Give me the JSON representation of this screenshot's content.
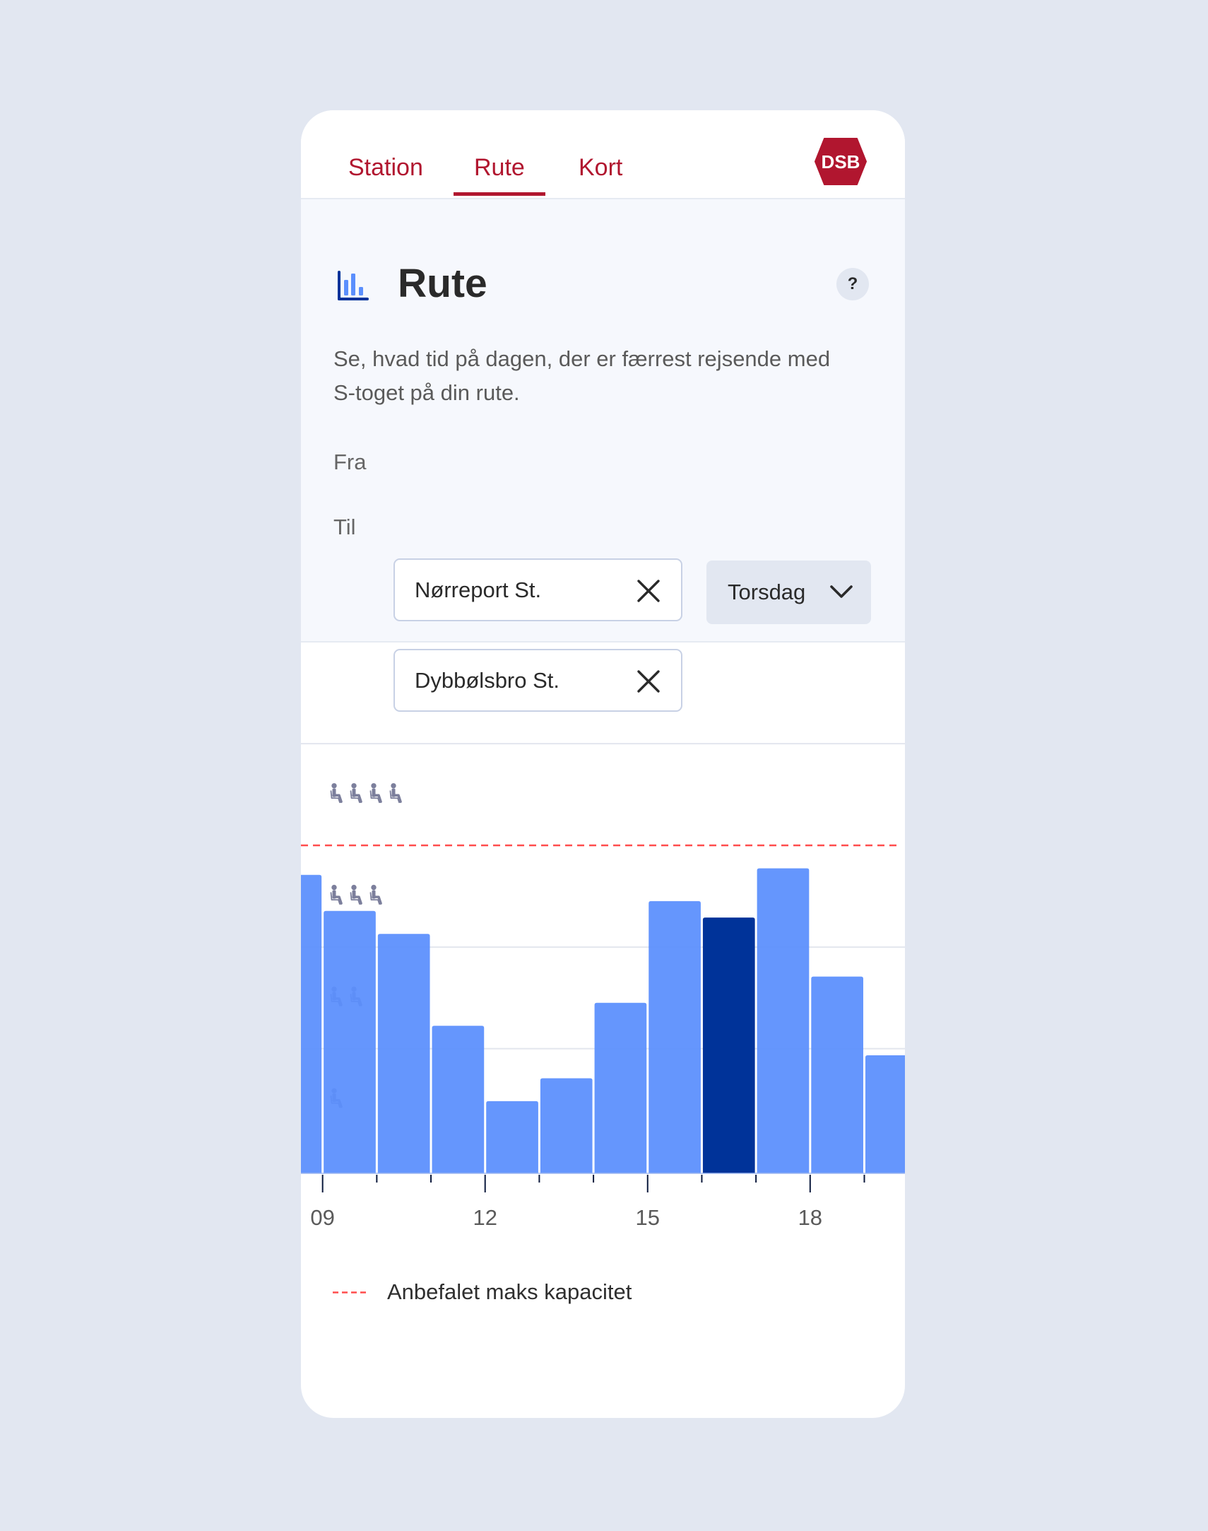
{
  "nav": {
    "tabs": [
      {
        "label": "Station",
        "active": false
      },
      {
        "label": "Rute",
        "active": true
      },
      {
        "label": "Kort",
        "active": false
      }
    ],
    "logo_text": "DSB"
  },
  "colors": {
    "brand_red": "#b1162f",
    "bar": "#5b8ffd",
    "bar_highlight": "#003399",
    "max_line": "#ff4d4d",
    "chair_icon": "#7c7f9c"
  },
  "header": {
    "icon": "bar-chart-icon",
    "title": "Rute",
    "help_label": "?",
    "description": "Se, hvad tid på dagen, der er færrest rejsende med S-toget på din rute."
  },
  "form": {
    "from": {
      "label": "Fra",
      "value": "Nørreport St.",
      "clear_icon": "close-icon"
    },
    "to": {
      "label": "Til",
      "value": "Dybbølsbro St.",
      "clear_icon": "close-icon"
    },
    "day": {
      "selected": "Torsdag",
      "icon": "chevron-down-icon"
    }
  },
  "chart_data": {
    "type": "bar",
    "title": "",
    "xlabel": "",
    "ylabel": "",
    "x": [
      8,
      9,
      10,
      11,
      12,
      13,
      14,
      15,
      16,
      17,
      18,
      19
    ],
    "xtick_labels": [
      {
        "hour": 9,
        "label": "09"
      },
      {
        "hour": 12,
        "label": "12"
      },
      {
        "hour": 15,
        "label": "15"
      },
      {
        "hour": 18,
        "label": "18"
      }
    ],
    "xlim": [
      8.6,
      19.75
    ],
    "values": [
      91,
      80,
      73,
      45,
      22,
      29,
      52,
      83,
      78,
      93,
      60,
      36
    ],
    "units": "percent of recommended max capacity",
    "highlight_hour": 16,
    "ylim": [
      0,
      130
    ],
    "y_levels": [
      {
        "chairs": 1,
        "value": 38
      },
      {
        "chairs": 2,
        "value": 69
      },
      {
        "chairs": 3,
        "value": 100
      },
      {
        "chairs": 4,
        "value": 131
      }
    ],
    "gridlines": [
      38,
      69,
      131
    ],
    "reference_line": {
      "value": 100,
      "style": "dashed",
      "label": "Anbefalet maks kapacitet"
    },
    "grid": true,
    "legend": {
      "position": "bottom-left",
      "entries": [
        "Anbefalet maks kapacitet"
      ]
    }
  },
  "legend": {
    "label": "Anbefalet maks kapacitet"
  }
}
